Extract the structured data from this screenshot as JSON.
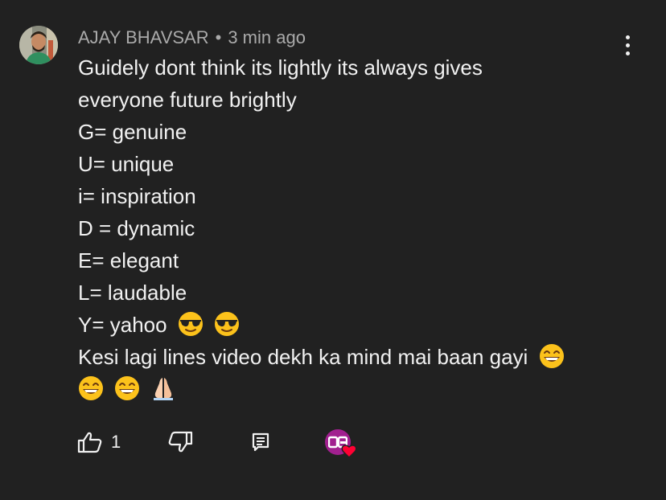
{
  "comment": {
    "author": "AJAY BHAVSAR",
    "separator": "•",
    "timestamp": "3 min ago",
    "lines": [
      "Guidely dont think its lightly its always gives",
      "everyone future brightly",
      "G= genuine",
      "U= unique",
      "i= inspiration",
      "D = dynamic",
      "E= elegant",
      "L= laudable",
      "Y= yahoo",
      "Kesi lagi lines video dekh ka mind mai baan gayi"
    ],
    "emojis": {
      "yahoo_line": [
        "smiling-face-with-sunglasses",
        "smiling-face-with-sunglasses"
      ],
      "kesi_line": [
        "beaming-face"
      ],
      "last_line": [
        "beaming-face",
        "beaming-face",
        "folded-hands"
      ]
    }
  },
  "actions": {
    "like_count": "1",
    "like_icon": "thumbs-up-icon",
    "dislike_icon": "thumbs-down-icon",
    "reply_icon": "reply-icon",
    "creator_heart_icon": "heart-icon"
  },
  "colors": {
    "background": "#212121",
    "text_primary": "#f1f1f1",
    "text_secondary": "#aaaaaa",
    "heart": "#ff0033",
    "creator_avatar": "#a1208f"
  }
}
